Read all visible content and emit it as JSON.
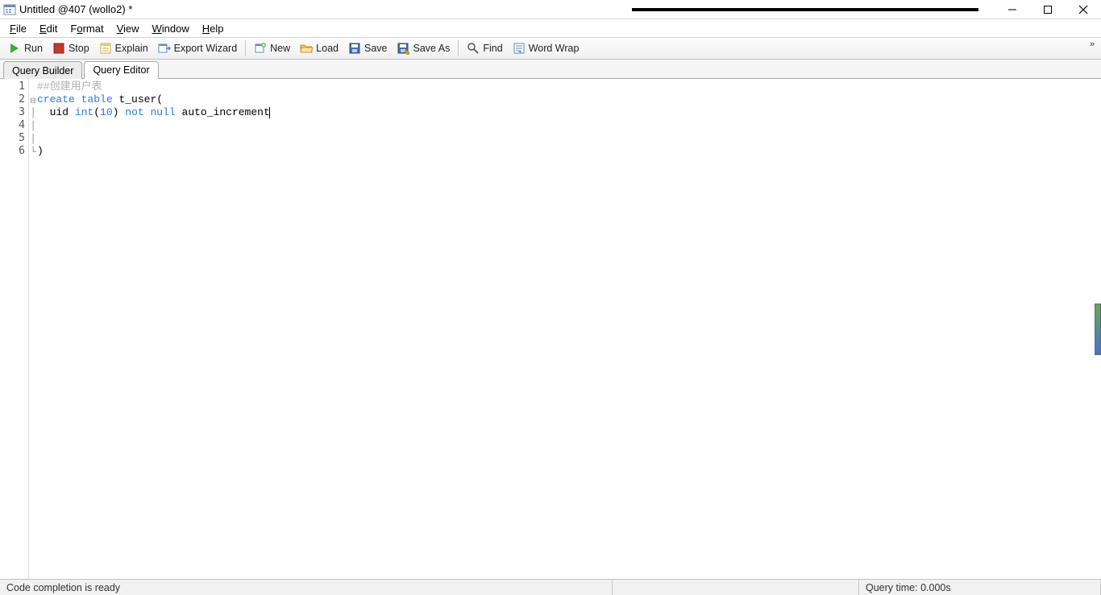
{
  "window": {
    "title": "Untitled @407 (wollo2) *"
  },
  "menu": {
    "file": "File",
    "edit": "Edit",
    "format": "Format",
    "view": "View",
    "window": "Window",
    "help": "Help"
  },
  "toolbar": {
    "run": "Run",
    "stop": "Stop",
    "explain": "Explain",
    "export_wizard": "Export Wizard",
    "new": "New",
    "load": "Load",
    "save": "Save",
    "save_as": "Save As",
    "find": "Find",
    "word_wrap": "Word Wrap"
  },
  "tabs": {
    "builder": "Query Builder",
    "editor": "Query Editor"
  },
  "editor": {
    "lines": [
      {
        "n": 1
      },
      {
        "n": 2,
        "fold": "⊟"
      },
      {
        "n": 3
      },
      {
        "n": 4
      },
      {
        "n": 5
      },
      {
        "n": 6
      }
    ],
    "code": {
      "l1_comment": "##创建用户表",
      "l2_kw1": "create",
      "l2_kw2": "table",
      "l2_ident": "t_user",
      "l2_paren": "(",
      "l3_ident": "uid",
      "l3_type": "int",
      "l3_paren_o": "(",
      "l3_num": "10",
      "l3_paren_c": ")",
      "l3_kw1": "not",
      "l3_kw2": "null",
      "l3_ident2": "auto_increment",
      "l6_paren": ")"
    }
  },
  "status": {
    "left": "Code completion is ready",
    "right": "Query time: 0.000s"
  }
}
